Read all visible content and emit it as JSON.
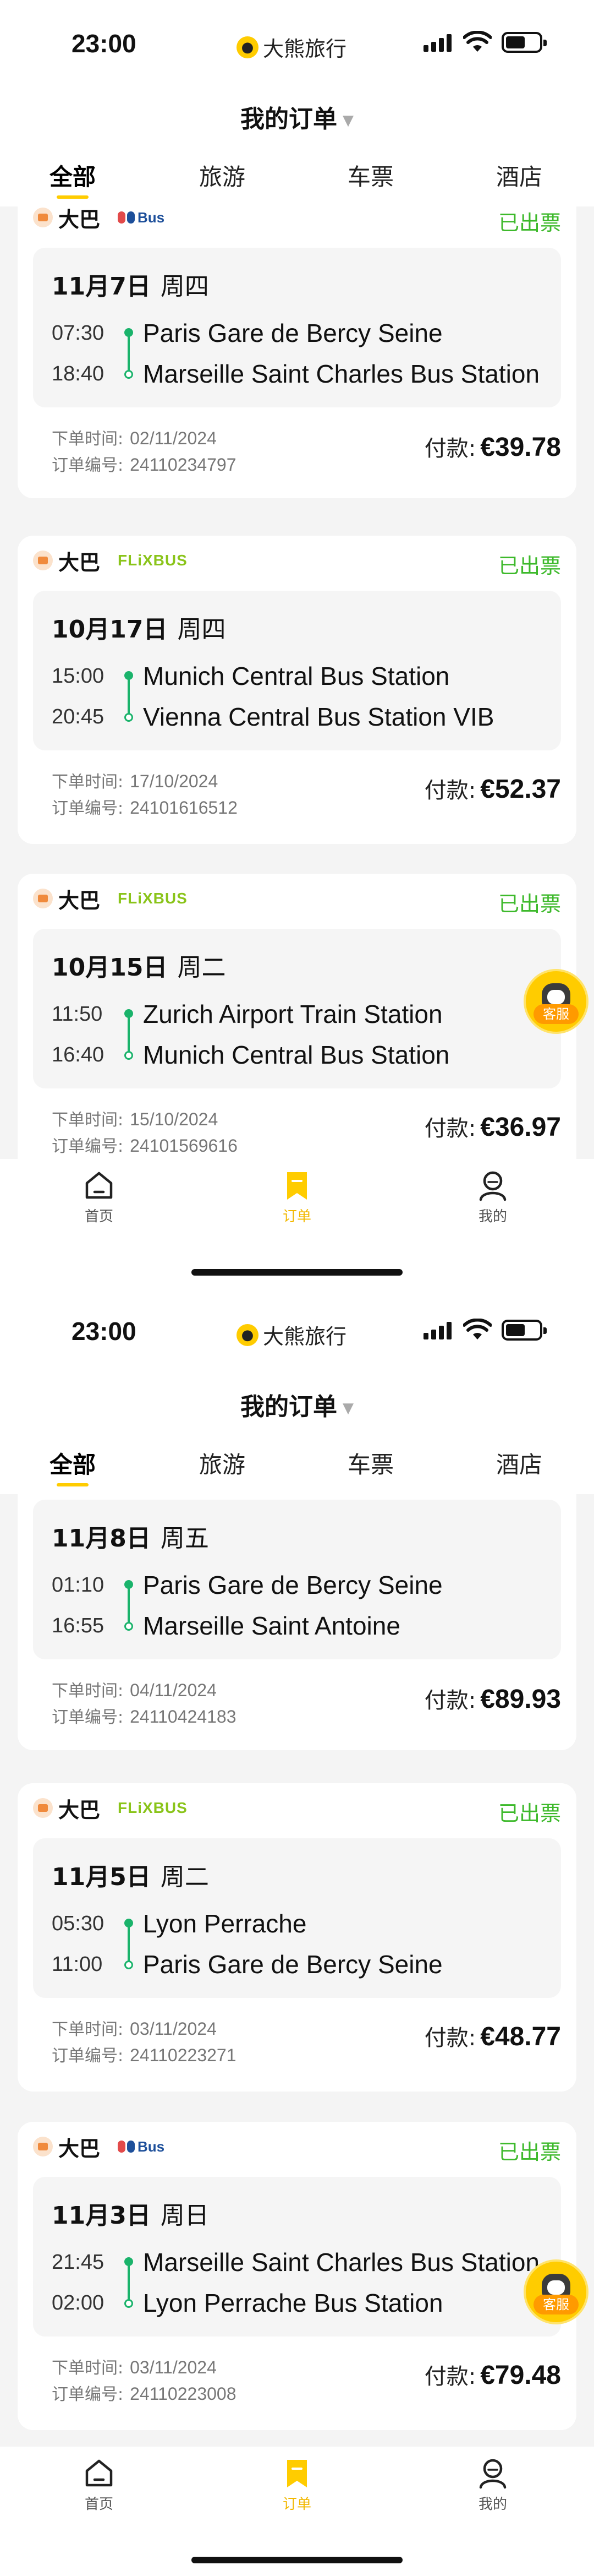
{
  "status_bar": {
    "time": "23:00",
    "app_name": "大熊旅行"
  },
  "header": {
    "title": "我的订单"
  },
  "tabs": [
    {
      "label": "全部",
      "active": true
    },
    {
      "label": "旅游",
      "active": false
    },
    {
      "label": "车票",
      "active": false
    },
    {
      "label": "酒店",
      "active": false
    }
  ],
  "labels": {
    "type": "大巴",
    "order_time": "下单时间:",
    "order_no": "订单编号:",
    "pay": "付款:",
    "service": "客服"
  },
  "brands": {
    "flixbus": "FLiXBUS",
    "bus": "Bus"
  },
  "screen1": {
    "orders": [
      {
        "brand": "bus",
        "status": "已出票",
        "date": "11月7日",
        "weekday": "周四",
        "dep_time": "07:30",
        "dep_station": "Paris Gare de Bercy Seine",
        "arr_time": "18:40",
        "arr_station": "Marseille Saint Charles Bus Station",
        "order_time": "02/11/2024",
        "order_no": "24110234797",
        "amount": "€39.78"
      },
      {
        "brand": "flixbus",
        "status": "已出票",
        "date": "10月17日",
        "weekday": "周四",
        "dep_time": "15:00",
        "dep_station": "Munich Central Bus Station",
        "arr_time": "20:45",
        "arr_station": "Vienna Central Bus Station VIB",
        "order_time": "17/10/2024",
        "order_no": "24101616512",
        "amount": "€52.37"
      },
      {
        "brand": "flixbus",
        "status": "已出票",
        "date": "10月15日",
        "weekday": "周二",
        "dep_time": "11:50",
        "dep_station": "Zurich Airport Train Station",
        "arr_time": "16:40",
        "arr_station": "Munich Central Bus Station",
        "order_time": "15/10/2024",
        "order_no": "24101569616",
        "amount": "€36.97"
      }
    ]
  },
  "screen2": {
    "orders": [
      {
        "date": "11月8日",
        "weekday": "周五",
        "dep_time": "01:10",
        "dep_station": "Paris Gare de Bercy Seine",
        "arr_time": "16:55",
        "arr_station": "Marseille Saint Antoine",
        "order_time": "04/11/2024",
        "order_no": "24110424183",
        "amount": "€89.93"
      },
      {
        "brand": "flixbus",
        "status": "已出票",
        "date": "11月5日",
        "weekday": "周二",
        "dep_time": "05:30",
        "dep_station": "Lyon Perrache",
        "arr_time": "11:00",
        "arr_station": "Paris Gare de Bercy Seine",
        "order_time": "03/11/2024",
        "order_no": "24110223271",
        "amount": "€48.77"
      },
      {
        "brand": "bus",
        "status": "已出票",
        "date": "11月3日",
        "weekday": "周日",
        "dep_time": "21:45",
        "dep_station": "Marseille Saint Charles Bus Station",
        "arr_time": "02:00",
        "arr_station": "Lyon Perrache Bus Station",
        "order_time": "03/11/2024",
        "order_no": "24110223008",
        "amount": "€79.48"
      }
    ]
  },
  "tabbar": [
    {
      "label": "首页",
      "icon": "home-icon",
      "active": false
    },
    {
      "label": "订单",
      "icon": "bookmark-icon",
      "active": true
    },
    {
      "label": "我的",
      "icon": "user-icon",
      "active": false
    }
  ],
  "colors": {
    "accent": "#ffcc00",
    "status_green": "#3db92b",
    "route_green": "#1ab36b",
    "flix_green": "#8ac41a"
  }
}
